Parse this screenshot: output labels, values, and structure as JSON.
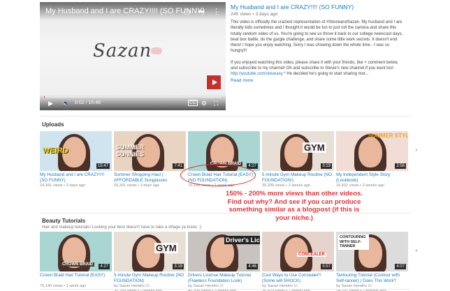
{
  "featured": {
    "player_title": "My Husband and I are CRAZY!!!! (SO FUNNY)",
    "logo_text": "Sazan",
    "time": "0:02 / 15:46",
    "progress": 0.003,
    "title": "My Husband and I are CRAZY!!!! (SO FUNNY)",
    "meta": "24K views • 3 days ago",
    "description": "This video is officially the craziest representation of #StevieandSazan. My husband and I are literally kids sometimes and I thought it would be fun to just roll the camera and share this totally random video of us. You're going to see us throw it back to our college newscast days, beat box battle, do the gargle challenge, and share some little work secrets. It doesn't end there! I hope you enjoy watching. Sorry I was chowing down the whole time - I was so hungry!!!",
    "description2_prefix": "If you enjoyed watching this video, please share it with your friends, like + comment below, and subscribe to my channel! Oh and subscribe to Stevie's new channel if you want too! ",
    "description2_link": "http://youtube.com/steveasy",
    "description2_suffix": " * He decided he's going to start sharing mor...",
    "read_more": "Read more"
  },
  "uploads": {
    "title": "Uploads",
    "videos": [
      {
        "title": "My Husband and I are CRAZY!!!! (SO FUNNY)",
        "meta": "24,341 views • 3 days ago",
        "duration": "15:47",
        "overlay": "WEIRD",
        "bg": "#cfe4ef"
      },
      {
        "title": "Summer Shopping Haul | AFFORDABLE Sunglasses",
        "meta": "20,331 views • 3 days ago",
        "duration": "7:41",
        "overlay": "SUMMER SUNNIES",
        "bg": "#e9d4c2"
      },
      {
        "title": "Crown Braid Hair Tutorial (EASY) (NO FOUNDATION)",
        "meta": "70,146 views • 1 week ago",
        "duration": "4:27",
        "overlay": "CROWN BRAID",
        "bg": "#a9d6d3"
      },
      {
        "title": "5 minute Gym Makeup Routine (NO FOUNDATION!)",
        "meta": "30,299 views • 2 weeks ago",
        "duration": "3:19",
        "overlay": "GYM",
        "bg": "#e8e0d6"
      },
      {
        "title": "My Independent Style Story (Lookbook)",
        "meta": "16,431 views • 2 weeks ago",
        "duration": "2:56",
        "overlay": "SUMMER STYLE",
        "bg": "#f2dcd6"
      }
    ]
  },
  "annotation": "150% - 200% more views than other videos. Find out why? And see if you can produce something similar as a blogpost (if this is your niche.)",
  "beauty": {
    "title": "Beauty Tutorials",
    "subtitle": "Hair and makeup tutorials! Looking your best doesn't have to take a village ya know. ;)",
    "videos": [
      {
        "title": "Crown Braid Hair Tutorial (EASY)",
        "meta": "70,146 views • 1 week ago",
        "duration": "4:27",
        "overlay": "CROWN BRAID",
        "bg": "#a9d6d3"
      },
      {
        "title": "5 minute Gym Makeup Routine (NO FOUNDATION)",
        "meta": "by Sazan Hendrix ☑\n30,299 views • 2 weeks ago",
        "duration": "3:19",
        "overlay": "GYM",
        "bg": "#e8e0d6"
      },
      {
        "title": "Drivers License Makeup Tutorial (Flawless Foundation Look)",
        "meta": "by Sazan Hendrix ☑\n40,998 views • 3 weeks ago",
        "duration": "4:46",
        "overlay": "Driver's License",
        "bg": "#c9c3bf"
      },
      {
        "title": "Cool Ways to Use Concealer!! (Some will SHOCK)",
        "meta": "by Sazan Hendrix ☑\n30,829 views • 1 month ago",
        "duration": "5:57",
        "overlay": "CONCEALER",
        "bg": "#e6d3cc"
      },
      {
        "title": "Tantouring Tutorial (Contour with Self-tanner) | Does This Work?",
        "meta": "by Sazan Hendrix ☑\n24,291 views • 2 months ago",
        "duration": "4:07",
        "overlay": "CONTOURING WITH SELF-TANNER",
        "bg": "#dcdcdc"
      }
    ]
  },
  "icons": {
    "clock": "clock-icon",
    "share": "share-icon",
    "more": "more-icon",
    "play": "play-icon",
    "volume": "volume-icon",
    "cc": "cc-icon",
    "gear": "gear-icon",
    "fullscreen": "fullscreen-icon",
    "next": "chevron-right-icon"
  },
  "colors": {
    "link": "#167ac6",
    "annotation": "#e8323a",
    "youtube_red": "#e52d27"
  }
}
